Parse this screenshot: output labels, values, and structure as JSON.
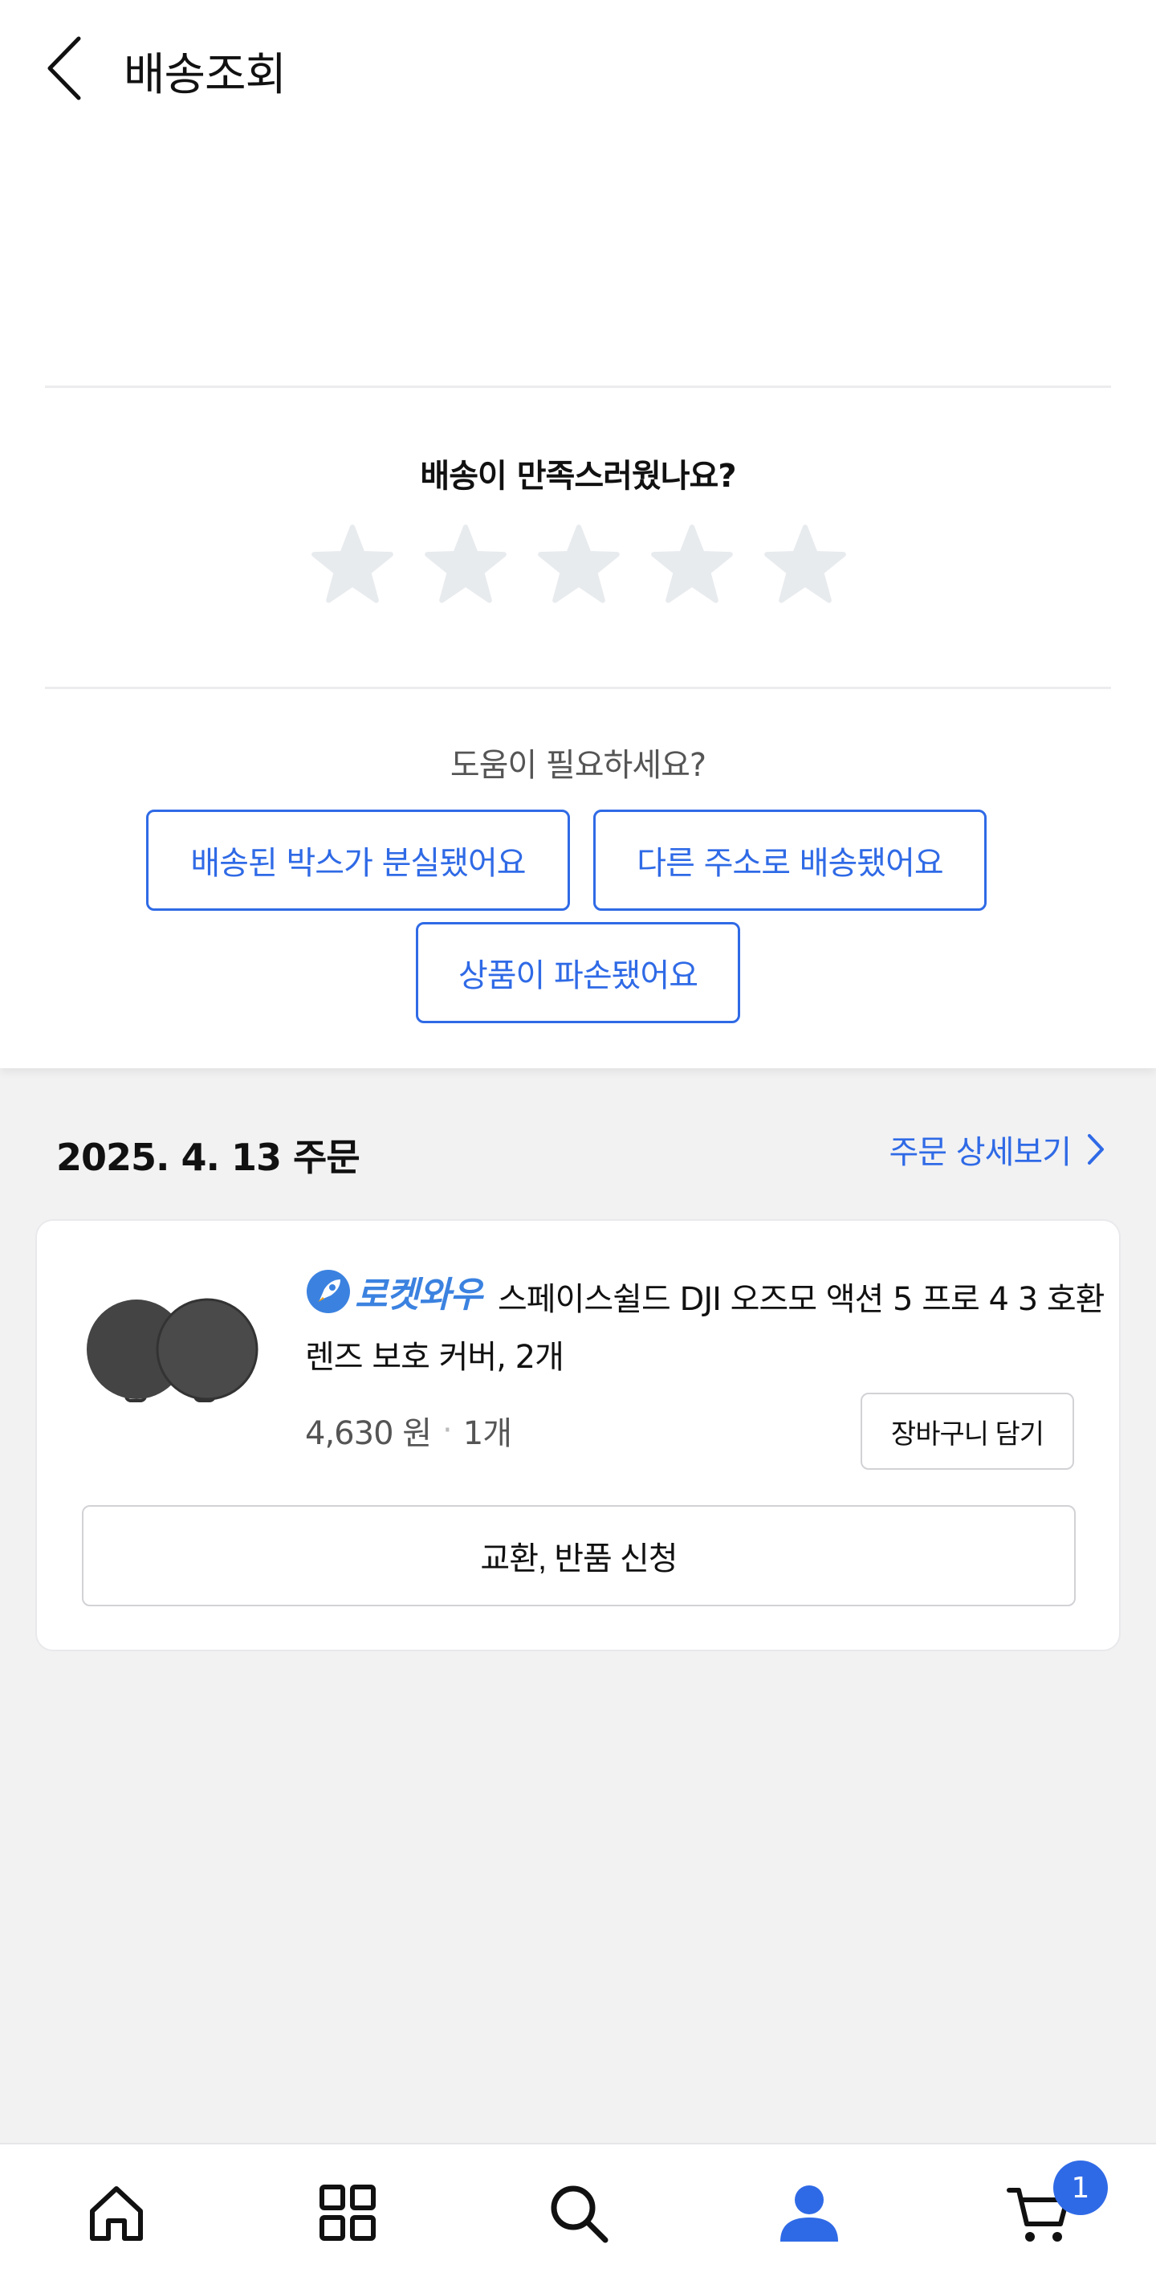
{
  "header": {
    "title": "배송조회"
  },
  "rating": {
    "question": "배송이 만족스러웠나요?",
    "stars": 5,
    "selected": 0,
    "star_color": "#e8ebee"
  },
  "help": {
    "question": "도움이 필요하세요?",
    "options": [
      "배송된 박스가 분실됐어요",
      "다른 주소로 배송됐어요",
      "상품이 파손됐어요"
    ]
  },
  "order": {
    "date": "2025. 4. 13 주문",
    "detail_link": "주문 상세보기",
    "item": {
      "badge": "로켓와우",
      "name": "스페이스쉴드 DJI 오즈모 액션 5 프로 4 3 호환 렌즈 보호 커버, 2개",
      "price": "4,630 원",
      "quantity": "1개",
      "cart_button": "장바구니 담기",
      "return_button": "교환, 반품 신청"
    }
  },
  "tabbar": {
    "items": [
      "home-icon",
      "category-grid-icon",
      "search-icon",
      "my-page-icon",
      "cart-icon"
    ],
    "active": "my-page-icon",
    "cart_count": "1",
    "accent": "#2f6ae6"
  }
}
